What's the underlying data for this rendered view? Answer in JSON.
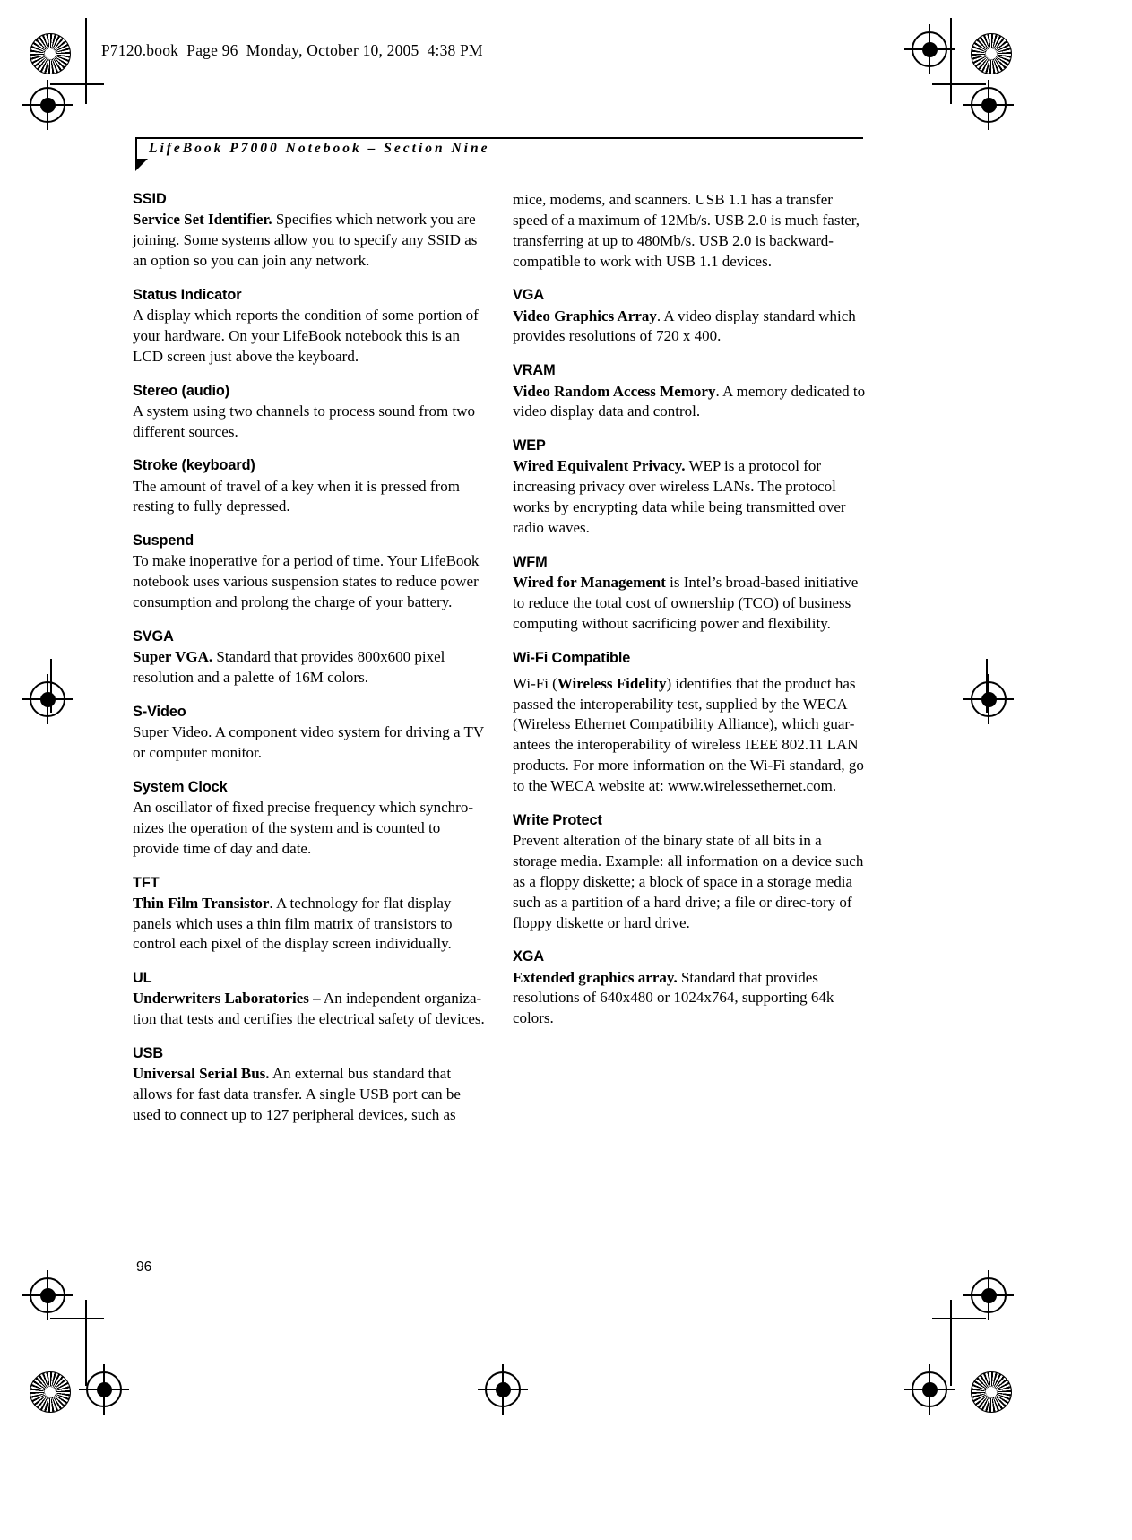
{
  "document": {
    "slug": "P7120.book  Page 96  Monday, October 10, 2005  4:38 PM",
    "running_head": "LifeBook P7000 Notebook – Section Nine",
    "folio": "96"
  },
  "columns": {
    "left": [
      {
        "term": "SSID",
        "lead": "Service Set Identifier.",
        "body": " Specifies which network you are joining. Some systems allow you to specify any SSID as an option so you can join any network."
      },
      {
        "term": "Status Indicator",
        "lead": "",
        "body": "A display which reports the condition of some portion of your hardware. On your LifeBook notebook this is an LCD screen just above the keyboard."
      },
      {
        "term": "Stereo (audio)",
        "lead": "",
        "body": "A system using two channels to process sound from two different sources."
      },
      {
        "term": "Stroke (keyboard)",
        "lead": "",
        "body": "The amount of travel of a key when it is pressed from resting to fully depressed."
      },
      {
        "term": "Suspend",
        "lead": "",
        "body": "To make inoperative for a period of time. Your LifeBook notebook uses various suspension states to reduce power consumption and prolong the charge of your battery."
      },
      {
        "term": "SVGA",
        "lead": "Super VGA.",
        "body": " Standard that provides 800x600 pixel resolution and a palette of 16M colors."
      },
      {
        "term": "S-Video",
        "lead": "",
        "body": "Super Video. A component video system for driving a TV or computer monitor."
      },
      {
        "term": "System Clock",
        "lead": "",
        "body": "An oscillator of fixed precise frequency which synchro-nizes the operation of the system and is counted to provide time of day and date."
      },
      {
        "term": "TFT",
        "lead": "Thin Film Transistor",
        "body": ". A technology for flat display panels which uses a thin film matrix of transistors to control each pixel of the display screen individually."
      },
      {
        "term": "UL",
        "lead": "Underwriters Laboratories",
        "body": " – An independent organiza-tion that tests and certifies the electrical safety of devices."
      },
      {
        "term": "USB",
        "lead": "Universal Serial Bus.",
        "body": " An external bus standard that allows for fast data transfer. A single USB port can be used to connect up to 127 peripheral devices, such as"
      }
    ],
    "right": [
      {
        "term": "",
        "lead": "",
        "body": "mice, modems, and scanners. USB 1.1 has a transfer speed of a maximum of 12Mb/s. USB 2.0 is much faster, transferring at up to 480Mb/s. USB 2.0 is backward-compatible to work with USB 1.1 devices."
      },
      {
        "term": "VGA",
        "lead": "Video Graphics Array",
        "body": ". A video display standard which provides resolutions of 720 x 400."
      },
      {
        "term": "VRAM",
        "lead": "Video Random Access Memory",
        "body": ". A memory dedicated to video display data and control."
      },
      {
        "term": "WEP",
        "lead": "Wired Equivalent Privacy.",
        "body": " WEP is a protocol for increasing privacy over wireless LANs. The protocol works by encrypting data while being transmitted over radio waves."
      },
      {
        "term": "WFM",
        "lead": "Wired for Management",
        "body": " is Intel’s broad-based initiative to reduce the total cost of ownership (TCO) of business computing without sacrificing power and flexibility."
      },
      {
        "term": "Wi-Fi Compatible",
        "lead": "",
        "body": "Wi-Fi (Wireless Fidelity) identifies that the product has passed the interoperability test, supplied by the WECA (Wireless Ethernet Compatibility Alliance), which guar-antees the interoperability of wireless IEEE 802.11 LAN products. For more information on the Wi-Fi standard, go to the WECA website at: www.wirelessethernet.com.",
        "inline_bold": "Wireless Fidelity"
      },
      {
        "term": "Write Protect",
        "lead": "",
        "body": "Prevent alteration of the binary state of all bits in a storage media. Example: all information on a device such as a floppy diskette; a block of space in a storage media such as a partition of a hard drive; a file or direc-tory of floppy diskette or hard drive."
      },
      {
        "term": "XGA",
        "lead": "Extended graphics array.",
        "body": " Standard that provides resolutions of 640x480 or 1024x764, supporting 64k colors."
      }
    ]
  }
}
